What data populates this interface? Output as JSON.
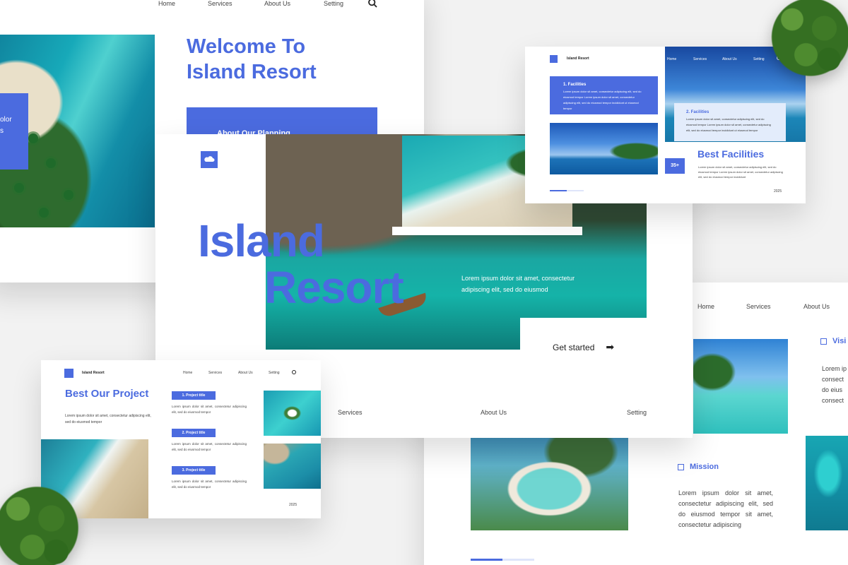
{
  "nav": {
    "home": "Home",
    "services": "Services",
    "about": "About Us",
    "setting": "Setting"
  },
  "slide_welcome": {
    "title_line1": "Welcome To",
    "title_line2": "Island Resort",
    "banner_text": "About Our Planning",
    "left_box_text_1": "olor",
    "left_box_text_2": "s"
  },
  "slide_hero": {
    "title_line1": "Island",
    "title_line2": "Resort",
    "paragraph": "Lorem ipsum dolor sit amet, consectetur adipiscing elit, sed do eiusmod",
    "cta": "Get started",
    "bottom_nav": {
      "services": "Services",
      "about": "About Us",
      "setting": "Setting"
    }
  },
  "slide_facilities": {
    "brand": "Island Resort",
    "item1_title": "1.  Facilities",
    "item1_text": "Lorem ipsum dolor sit amet, consectetur adipiscing elit, sed do eiusmod tempor Lorem ipsum dolor sit amet, consectetur adipiscing elit, sed do eiusmod tempor incididunt ut eiusmod tempor",
    "item2_title": "2.  Facilities",
    "item2_text": "Lorem ipsum dolor sit amet, consectetur adipiscing elit, sed do eiusmod tempor Lorem ipsum dolor sit amet, consectetur adipiscing elit, sed do eiusmod tempor incididunt ut eiusmod tempor",
    "heading": "Best Facilities",
    "badge": "35+",
    "badge_text": "Lorem ipsum dolor sit amet, consectetur adipiscing elit, sed do eiusmod tempor Lorem ipsum dolor sit amet, consectetur adipiscing elit, sed do eiusmod tempor incididunt",
    "year": "2025"
  },
  "slide_project": {
    "brand": "Island Resort",
    "heading": "Best Our Project",
    "intro": "Lorem ipsum dolor sit amet, consectetur adipiscing elit, sed do eiusmod tempor",
    "projects": [
      {
        "title": "1. Project title",
        "text": "Lorem ipsum dolor sit amet, consectetur adipiscing elit, sed do eiusmod tempor"
      },
      {
        "title": "2. Project title",
        "text": "Lorem ipsum dolor sit amet, consectetur adipiscing elit, sed do eiusmod tempor"
      },
      {
        "title": "3. Project title",
        "text": "Lorem ipsum dolor sit amet, consectetur adipiscing elit, sed do eiusmod tempor"
      }
    ],
    "year": "2025"
  },
  "slide_vision": {
    "nav": {
      "home": "Home",
      "services": "Services",
      "about": "About Us"
    },
    "vision_title": "Visi",
    "vision_text": [
      "Lorem ip",
      "consect",
      "do eius",
      "consect"
    ],
    "mission_title": "Mission",
    "mission_text": "Lorem ipsum dolor sit amet, consectetur adipiscing elit, sed do eiusmod tempor sit amet, consectetur adipiscing"
  },
  "colors": {
    "accent": "#4b6bdf",
    "background": "#f2f2f2"
  }
}
